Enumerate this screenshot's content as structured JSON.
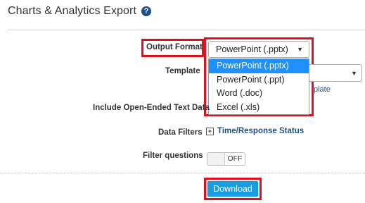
{
  "header": {
    "title": "Charts & Analytics Export",
    "help_icon": "?"
  },
  "form": {
    "output_format": {
      "label": "Output Format",
      "selected": "PowerPoint (.pptx)",
      "options": [
        "PowerPoint (.pptx)",
        "PowerPoint (.ppt)",
        "Word (.doc)",
        "Excel (.xls)"
      ]
    },
    "template": {
      "label": "Template",
      "link_fragment": "plate"
    },
    "open_ended": {
      "label": "Include Open-Ended Text Data"
    },
    "data_filters": {
      "label": "Data Filters",
      "link": "Time/Response Status"
    },
    "filter_questions": {
      "label": "Filter questions",
      "toggle_state": "OFF"
    },
    "download_label": "Download"
  },
  "colors": {
    "highlight_border": "#e0101d",
    "selected_option": "#1e90ff",
    "button": "#1a9de0",
    "link": "#1f4e8c"
  },
  "icons": {
    "help": "help-circle-icon",
    "dropdown": "caret-down-icon",
    "expand": "plus-square-icon"
  }
}
